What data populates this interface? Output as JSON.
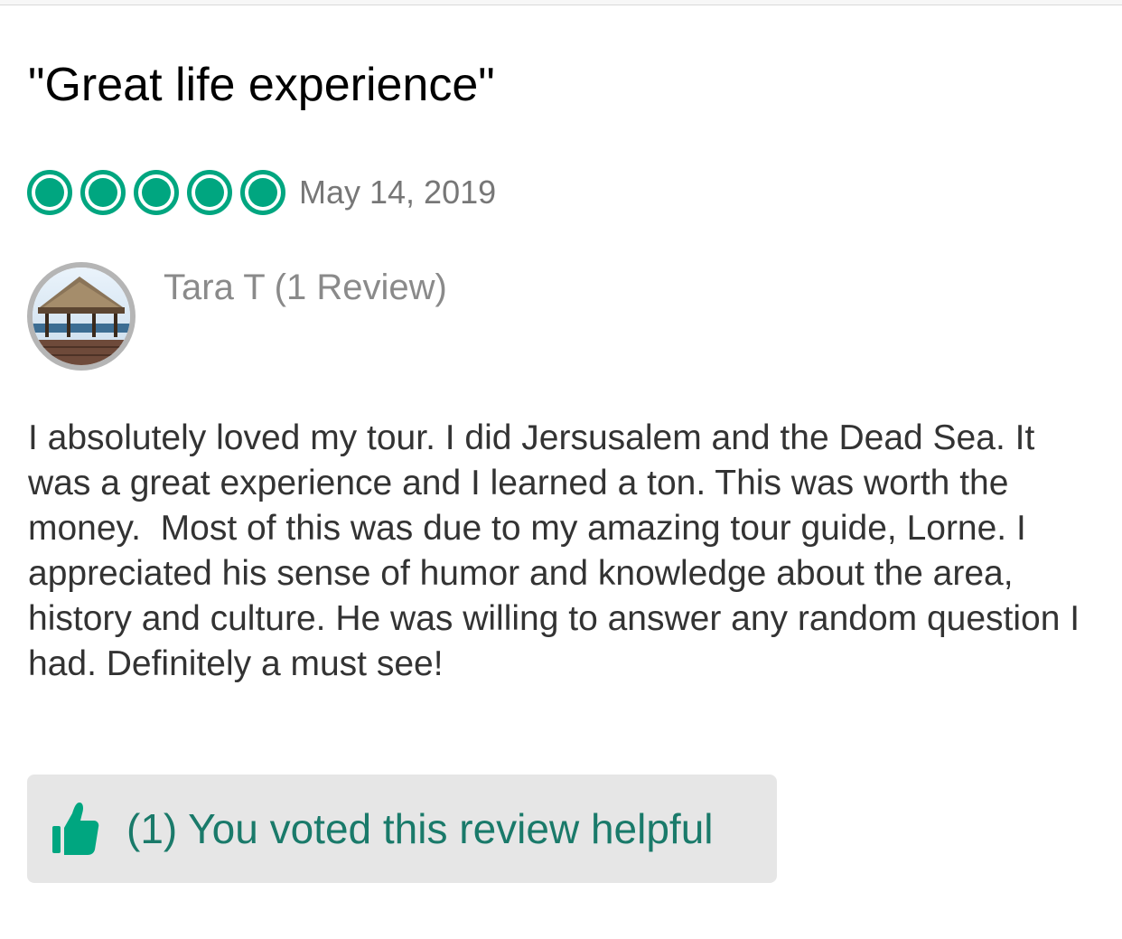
{
  "review": {
    "title": "\"Great life experience\"",
    "rating": 5,
    "rating_max": 5,
    "date": "May 14, 2019",
    "reviewer_name": "Tara T",
    "reviewer_review_count": "(1 Review)",
    "body": "I absolutely loved my tour. I did Jersusalem and the Dead Sea. It was a great experience and I learned a ton. This was worth the money.  Most of this was due to my amazing tour guide, Lorne. I appreciated his sense of humor and knowledge about the area, history and culture. He was willing to answer any random question I had. Definitely a must see!",
    "helpful_label": "(1) You voted this review helpful"
  },
  "icons": {
    "rating": "rating-bubble-icon",
    "helpful": "thumbs-up-icon",
    "avatar": "avatar-photo"
  },
  "colors": {
    "accent": "#00a680",
    "helpful_text": "#1a7a6a",
    "helpful_bg": "#e6e6e6",
    "date": "#777777",
    "reviewer": "#8a8a8a",
    "body": "#333333"
  }
}
